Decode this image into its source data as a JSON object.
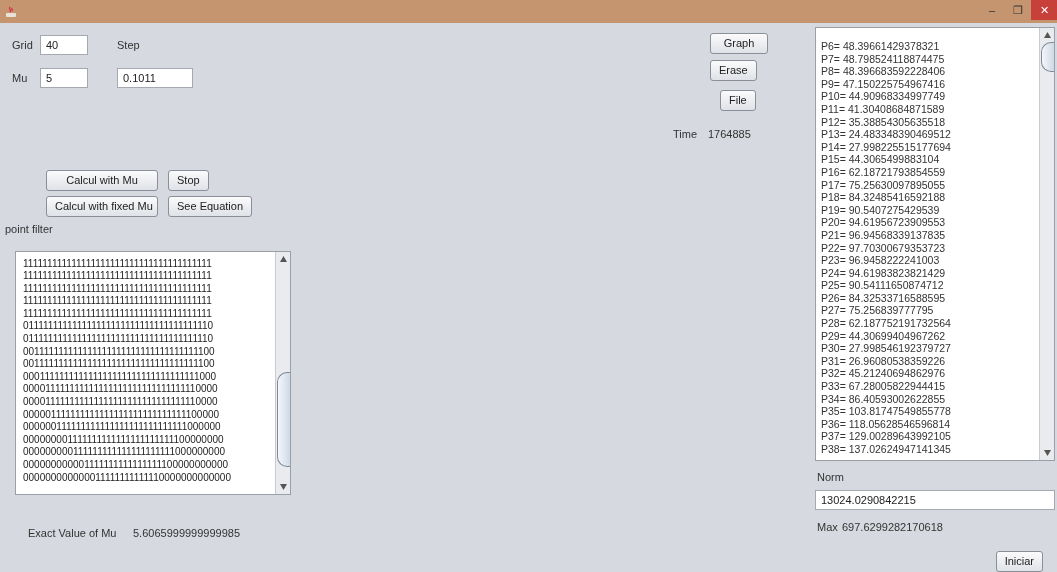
{
  "window": {
    "title_controls": [
      "–",
      "❐",
      "✕"
    ]
  },
  "grid": {
    "label": "Grid",
    "value": "40"
  },
  "step": {
    "label": "Step",
    "value": "0.1011"
  },
  "mu": {
    "label": "Mu",
    "value": "5"
  },
  "buttons_row_1": [
    "Calcul with Mu",
    "Stop"
  ],
  "buttons_row_2": [
    "Calcul with fixed Mu",
    "See  Equation"
  ],
  "filter_label": "point filter",
  "matrix_rows": [
    "111111111111111111111111111111111111111",
    "111111111111111111111111111111111111111",
    "111111111111111111111111111111111111111",
    "111111111111111111111111111111111111111",
    "111111111111111111111111111111111111111",
    "011111111111111111111111111111111111110",
    "011111111111111111111111111111111111110",
    "001111111111111111111111111111111111100",
    "001111111111111111111111111111111111100",
    "000111111111111111111111111111111111000",
    "000011111111111111111111111111111110000",
    "000011111111111111111111111111111110000",
    "000001111111111111111111111111111100000",
    "000000111111111111111111111111111000000",
    "000000001111111111111111111111100000000",
    "000000000111111111111111111111000000000",
    "000000000001111111111111111100000000000",
    "000000000000011111111111110000000000000"
  ],
  "exact_mu": {
    "label": "Exact Value of Mu",
    "value": "5.6065999999999985"
  },
  "side_buttons": [
    "Graph",
    "Erase",
    "File"
  ],
  "time": {
    "label": "Time",
    "value": "1764885"
  },
  "results": [
    "P6= 48.39661429378321",
    "P7= 48.798524118874475",
    "P8= 48.396683592228406",
    "P9= 47.150225754967416",
    "P10= 44.90968334997749",
    "P11= 41.30408684871589",
    "P12= 35.38854305635518",
    "P13= 24.483348390469512",
    "P14= 27.998225515177694",
    "P15= 44.3065499883104",
    "P16= 62.18721793854559",
    "P17= 75.25630097895055",
    "P18= 84.32485416592188",
    "P19= 90.5407275429539",
    "P20= 94.61956723909553",
    "P21= 96.94568339137835",
    "P22= 97.70300679353723",
    "P23= 96.9458222241003",
    "P24= 94.61983823821429",
    "P25= 90.54111650874712",
    "P26= 84.32533716588595",
    "P27= 75.256839777795",
    "P28= 62.187752191732564",
    "P29= 44.30699404967262",
    "P30= 27.998546192379727",
    "P31= 26.96080538359226",
    "P32= 45.21240694862976",
    "P33= 67.28005822944415",
    "P34= 86.40593002622855",
    "P35= 103.81747549855778",
    "P36= 118.05628546596814",
    "P37= 129.00289643992105",
    "P38= 137.02624947141345"
  ],
  "norm": {
    "label": "Norm",
    "value": "13024.0290842215"
  },
  "max": {
    "label": "Max",
    "value": "697.6299282170618"
  },
  "start_button": "Iniciar"
}
